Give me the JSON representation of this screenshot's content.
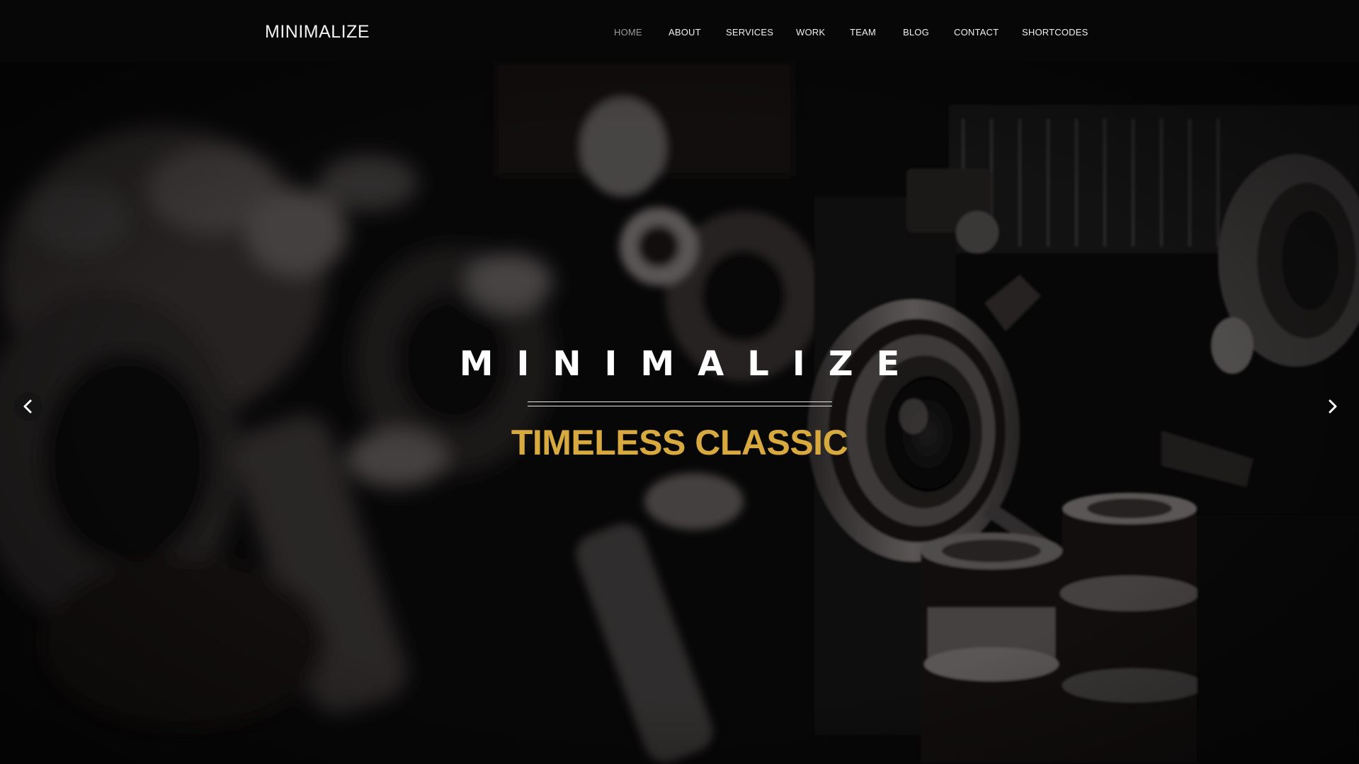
{
  "brand": "MINIMALIZE",
  "nav": {
    "items": [
      {
        "label": "HOME",
        "active": true
      },
      {
        "label": "ABOUT",
        "active": false
      },
      {
        "label": "SERVICES",
        "active": false
      },
      {
        "label": "WORK",
        "active": false
      },
      {
        "label": "TEAM",
        "active": false
      },
      {
        "label": "BLOG",
        "active": false
      },
      {
        "label": "CONTACT",
        "active": false
      },
      {
        "label": "SHORTCODES",
        "active": false
      }
    ]
  },
  "hero": {
    "title": "MINIMALIZE",
    "subtitle": "TIMELESS CLASSIC",
    "background": "vintage-cameras-photo",
    "prev_icon": "chevron-left-icon",
    "next_icon": "chevron-right-icon"
  },
  "colors": {
    "navbar": "#070707",
    "accent": "#d7a93f",
    "nav_active": "#9a9a9a",
    "nav_text": "#f0f0f0"
  }
}
